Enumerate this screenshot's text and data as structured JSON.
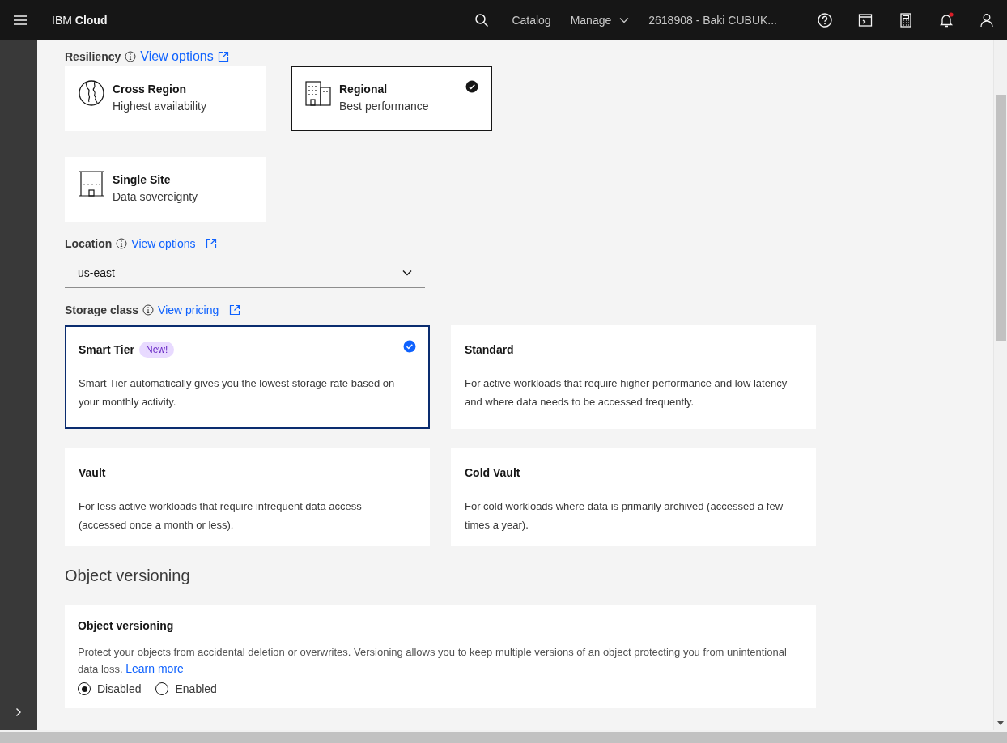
{
  "header": {
    "brand": "IBM **Cloud**",
    "nav": [
      {
        "label": "Catalog",
        "kind": "link"
      },
      {
        "label": "Manage",
        "kind": "menu"
      }
    ],
    "account": "2618908 - Baki CUBUK...",
    "has_unread_notifications": true
  },
  "resiliency": {
    "label": "Resiliency",
    "link": "View options",
    "options": [
      {
        "title": "Cross Region",
        "subtitle": "Highest availability",
        "kind": "globe",
        "selected": false
      },
      {
        "title": "Regional",
        "subtitle": "Best performance",
        "kind": "buildings",
        "selected": true
      },
      {
        "title": "Single Site",
        "subtitle": "Data sovereignty",
        "kind": "building",
        "selected": false
      }
    ]
  },
  "location": {
    "label": "Location",
    "link": "View options",
    "value": "us-east"
  },
  "storage_class": {
    "label": "Storage class",
    "link": "View pricing",
    "options": [
      {
        "title": "Smart Tier",
        "badge": "New!",
        "description": "Smart Tier automatically gives you the lowest storage rate based on your monthly activity.",
        "selected": true
      },
      {
        "title": "Standard",
        "description": "For active workloads that require higher performance and low latency and where data needs to be accessed frequently.",
        "selected": false
      },
      {
        "title": "Vault",
        "description": "For less active workloads that require infrequent data access (accessed once a month or less).",
        "selected": false
      },
      {
        "title": "Cold Vault",
        "description": "For cold workloads where data is primarily archived (accessed a few times a year).",
        "selected": false
      }
    ]
  },
  "object_versioning": {
    "heading": "Object versioning",
    "title": "Object versioning",
    "description": "Protect your objects from accidental deletion or overwrites. Versioning allows you to keep multiple versions of an object protecting you from unintentional data loss.",
    "link": "Learn more",
    "options": [
      {
        "label": "Disabled",
        "selected": true
      },
      {
        "label": "Enabled",
        "selected": false
      }
    ]
  }
}
